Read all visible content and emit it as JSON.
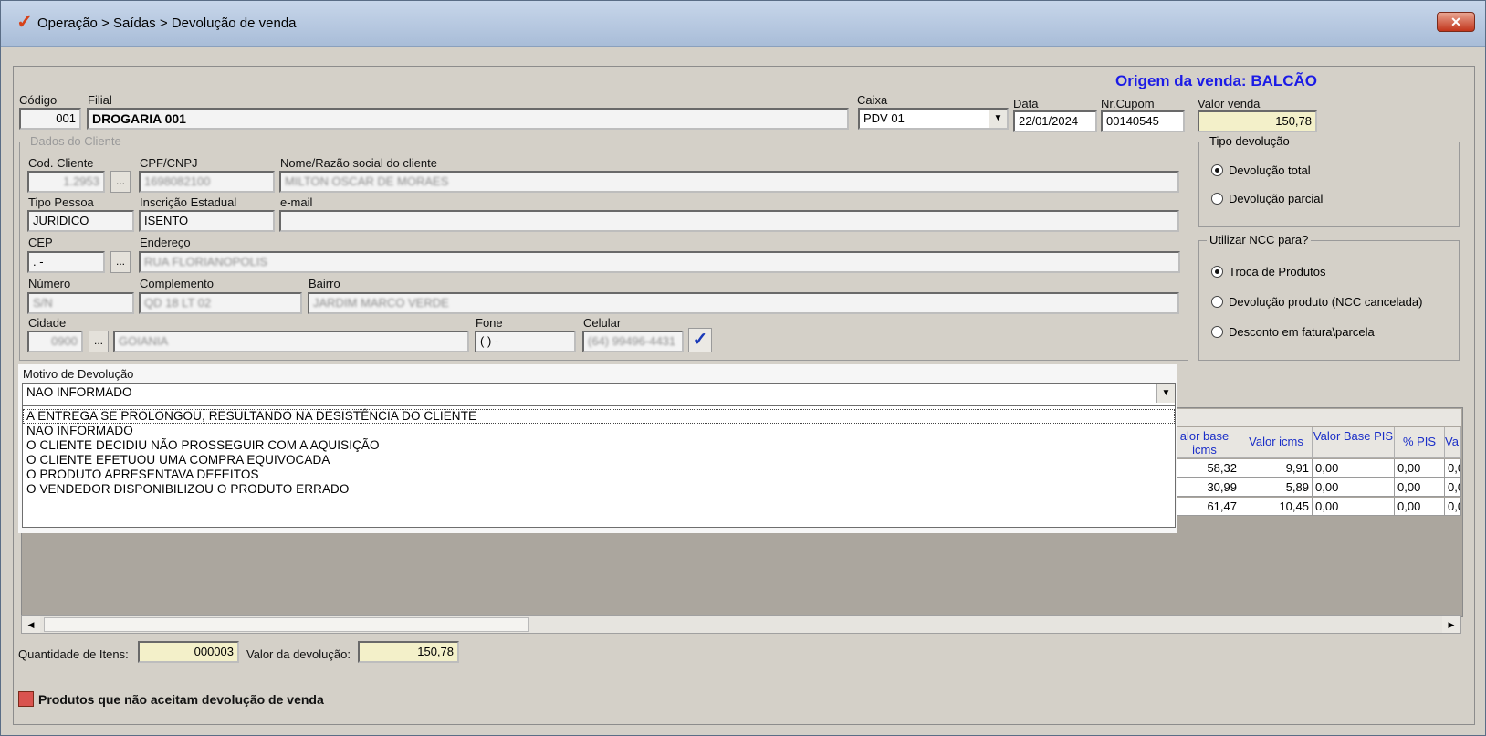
{
  "window": {
    "title": "Operação > Saídas > Devolução de venda",
    "close_label": "✕"
  },
  "origin": "Origem da venda: BALCÃO",
  "header": {
    "codigo_label": "Código",
    "codigo_value": "001",
    "filial_label": "Filial",
    "filial_value": "DROGARIA 001",
    "caixa_label": "Caixa",
    "caixa_value": "PDV 01",
    "data_label": "Data",
    "data_value": "22/01/2024",
    "cupom_label": "Nr.Cupom",
    "cupom_value": "00140545",
    "valor_venda_label": "Valor venda",
    "valor_venda_value": "150,78"
  },
  "cliente": {
    "group_title": "Dados do Cliente",
    "cod_label": "Cod. Cliente",
    "cod_value": "1.2953",
    "cpf_label": "CPF/CNPJ",
    "cpf_value": "1698082100",
    "nome_label": "Nome/Razão social do cliente",
    "nome_value": "MILTON OSCAR DE MORAES",
    "tipo_label": "Tipo Pessoa",
    "tipo_value": "JURIDICO",
    "ie_label": "Inscrição Estadual",
    "ie_value": "ISENTO",
    "email_label": "e-mail",
    "email_value": "",
    "cep_label": "CEP",
    "cep_value": ". -",
    "endereco_label": "Endereço",
    "endereco_value": "RUA FLORIANOPOLIS",
    "numero_label": "Número",
    "numero_value": "S/N",
    "complemento_label": "Complemento",
    "complemento_value": "QD 18 LT 02",
    "bairro_label": "Bairro",
    "bairro_value": "JARDIM MARCO VERDE",
    "cidade_label": "Cidade",
    "cidade_code": "0900",
    "cidade_value": "GOIANIA",
    "fone_label": "Fone",
    "fone_value": "( )    -",
    "celular_label": "Celular",
    "celular_value": "(64) 99496-4431",
    "ellipsis": "..."
  },
  "tipo_devolucao": {
    "title": "Tipo devolução",
    "options": [
      "Devolução total",
      "Devolução parcial"
    ],
    "selected": 0
  },
  "ncc": {
    "title": "Utilizar NCC para?",
    "options": [
      "Troca de Produtos",
      "Devolução produto (NCC cancelada)",
      "Desconto em fatura\\parcela"
    ],
    "selected": 0
  },
  "motivo": {
    "label": "Motivo de Devolução",
    "value": "NAO INFORMADO",
    "options": [
      "A ENTREGA SE PROLONGOU, RESULTANDO NA DESISTÊNCIA DO CLIENTE",
      "NAO INFORMADO",
      "O CLIENTE DECIDIU NÃO PROSSEGUIR COM A AQUISIÇÃO",
      "O CLIENTE EFETUOU  UMA COMPRA EQUIVOCADA",
      "O PRODUTO APRESENTAVA DEFEITOS",
      "O VENDEDOR DISPONIBILIZOU O PRODUTO ERRADO"
    ],
    "highlighted": 0
  },
  "grid": {
    "headers": [
      "alor base icms",
      "Valor icms",
      "Valor Base PIS",
      "% PIS",
      "Va"
    ],
    "rows": [
      [
        "58,32",
        "9,91",
        "0,00",
        "0,00",
        "0,0"
      ],
      [
        "30,99",
        "5,89",
        "0,00",
        "0,00",
        "0,0"
      ],
      [
        "61,47",
        "10,45",
        "0,00",
        "0,00",
        "0,0"
      ]
    ]
  },
  "footer": {
    "qtd_label": "Quantidade de Itens:",
    "qtd_value": "000003",
    "valor_label": "Valor da devolução:",
    "valor_value": "150,78",
    "legend_label": "Produtos que não aceitam devolução de venda",
    "legend_color": "#d9534f"
  },
  "colors": {
    "origin": "#1b1be6",
    "header_text": "#1a2ec8",
    "check": "#1a3ab8"
  }
}
